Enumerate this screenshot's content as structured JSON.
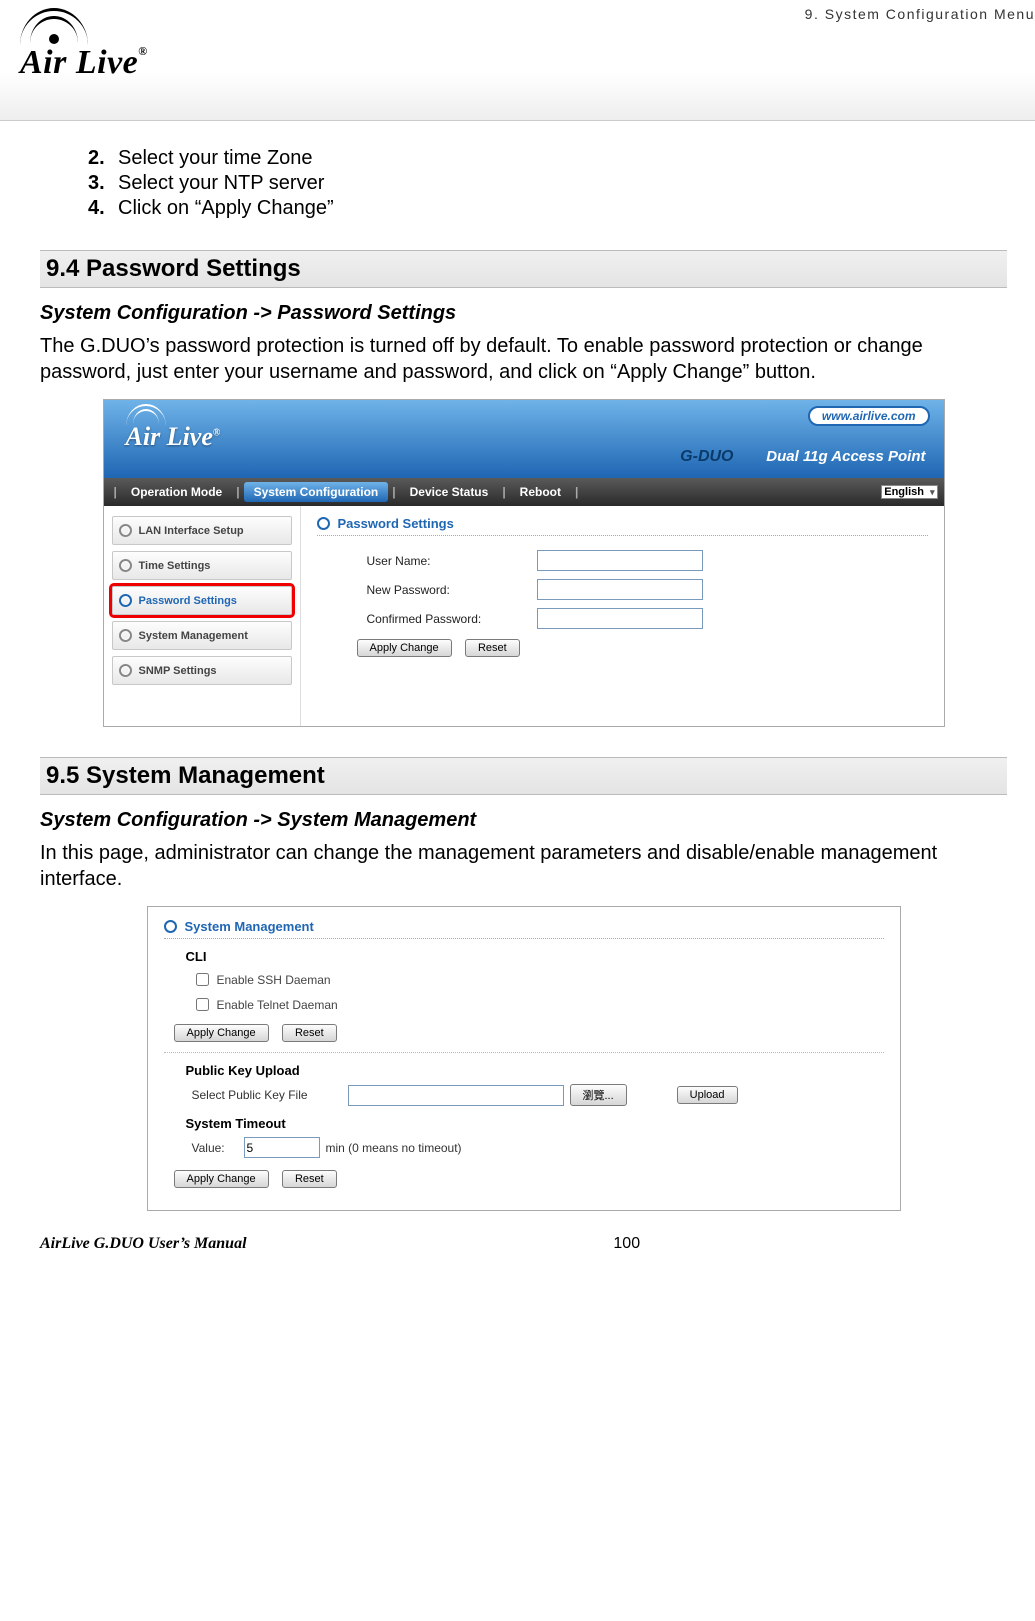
{
  "header": {
    "chapter": "9.  System  Configuration  Menu",
    "logo_text": "Air Live",
    "logo_tm": "®"
  },
  "steps": [
    {
      "num": "2.",
      "text": "Select your time Zone"
    },
    {
      "num": "3.",
      "text": "Select your NTP server"
    },
    {
      "num": "4.",
      "text": "Click on “Apply Change”"
    }
  ],
  "section94": {
    "title": "9.4 Password  Settings",
    "breadcrumb": "System Configuration -> Password Settings",
    "body": "The G.DUO’s password protection is turned off by default.    To enable password protection or change password, just enter your username and password, and click on “Apply Change” button."
  },
  "router": {
    "logo": "Air Live",
    "logo_tm": "®",
    "url": "www.airlive.com",
    "model": "G-DUO",
    "tagline": "Dual 11g Access Point",
    "nav": {
      "operation_mode": "Operation Mode",
      "system_config": "System Configuration",
      "device_status": "Device Status",
      "reboot": "Reboot",
      "lang": "English"
    },
    "side": {
      "lan": "LAN Interface Setup",
      "time": "Time Settings",
      "password": "Password Settings",
      "sysmgmt": "System Management",
      "snmp": "SNMP Settings"
    },
    "panel": {
      "title": "Password Settings",
      "user_label": "User Name:",
      "newpw_label": "New Password:",
      "confpw_label": "Confirmed Password:",
      "apply": "Apply Change",
      "reset": "Reset"
    }
  },
  "section95": {
    "title": "9.5 System  Management",
    "breadcrumb": "System Configuration -> System Management",
    "body": "In this page, administrator can change the management parameters and disable/enable management interface."
  },
  "mgmt": {
    "title": "System Management",
    "cli": "CLI",
    "ssh": "Enable SSH Daeman",
    "telnet": "Enable Telnet Daeman",
    "apply": "Apply Change",
    "reset": "Reset",
    "pubkey_title": "Public Key Upload",
    "pubkey_label": "Select Public Key File",
    "browse": "瀏覽...",
    "upload": "Upload",
    "timeout_title": "System Timeout",
    "value_label": "Value:",
    "value": "5",
    "value_suffix": "min (0 means no timeout)"
  },
  "footer": {
    "left": "AirLive G.DUO User’s Manual",
    "page": "100"
  }
}
